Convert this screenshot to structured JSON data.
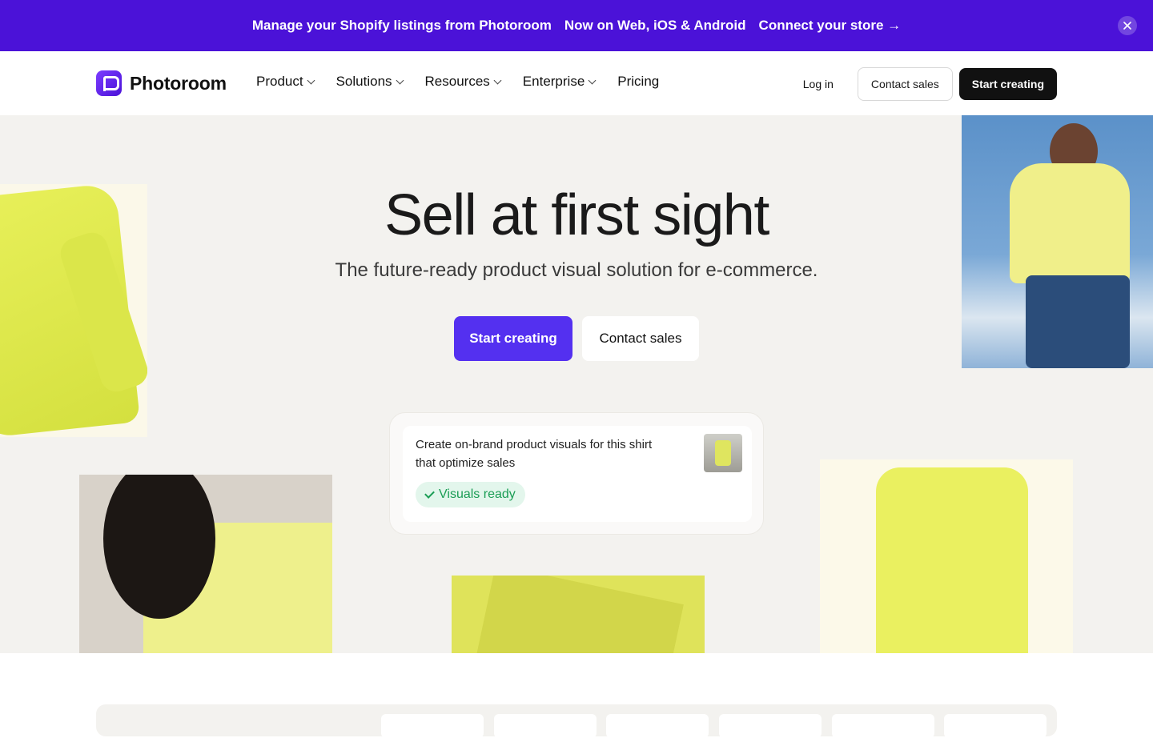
{
  "announcement": {
    "text1": "Manage your Shopify listings from Photoroom",
    "text2": "Now on Web, iOS & Android",
    "link": "Connect your store →",
    "close_icon": "close-icon"
  },
  "nav": {
    "brand": "Photoroom",
    "items": [
      {
        "label": "Product",
        "has_dropdown": true
      },
      {
        "label": "Solutions",
        "has_dropdown": true
      },
      {
        "label": "Resources",
        "has_dropdown": true
      },
      {
        "label": "Enterprise",
        "has_dropdown": true
      },
      {
        "label": "Pricing",
        "has_dropdown": false
      }
    ],
    "login": "Log in",
    "contact": "Contact sales",
    "start": "Start creating"
  },
  "hero": {
    "title": "Sell at first sight",
    "subtitle": "The future-ready product visual solution for e-commerce.",
    "cta_primary": "Start creating",
    "cta_secondary": "Contact sales"
  },
  "chat": {
    "prompt": "Create on-brand product visuals for this shirt that optimize sales",
    "status": "Visuals ready"
  },
  "colors": {
    "announcement_bg": "#4b12d8",
    "primary": "#5430f0",
    "hero_bg": "#f3f2ef",
    "success": "#1b9d55"
  }
}
